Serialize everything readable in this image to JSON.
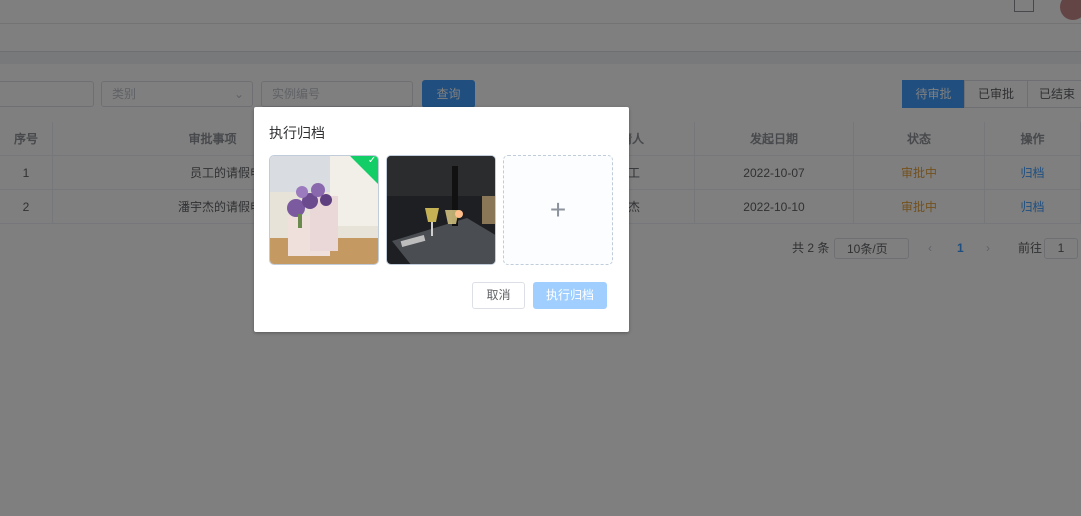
{
  "filters": {
    "category_placeholder": "类别",
    "instance_placeholder": "实例编号",
    "query_label": "查询"
  },
  "tabs": [
    "待审批",
    "已审批",
    "已结束"
  ],
  "table": {
    "headers": [
      "序号",
      "审批事项",
      "请人",
      "发起日期",
      "状态",
      "操作"
    ],
    "rows": [
      [
        "1",
        "员工的请假申",
        "工",
        "2022-10-07",
        "审批中",
        "归档"
      ],
      [
        "2",
        "潘宇杰的请假申",
        "宇杰",
        "2022-10-10",
        "审批中",
        "归档"
      ]
    ]
  },
  "pagination": {
    "total": "共 2 条",
    "page_size": "10条/页",
    "current_page": "1",
    "goto_label": "前往",
    "goto_value": "1"
  },
  "dialog": {
    "title": "执行归档",
    "cancel_label": "取消",
    "confirm_label": "执行归档",
    "add_symbol": "+"
  },
  "colors": {
    "primary": "#409eff",
    "warning": "#e6a23c",
    "success": "#13ce66"
  }
}
